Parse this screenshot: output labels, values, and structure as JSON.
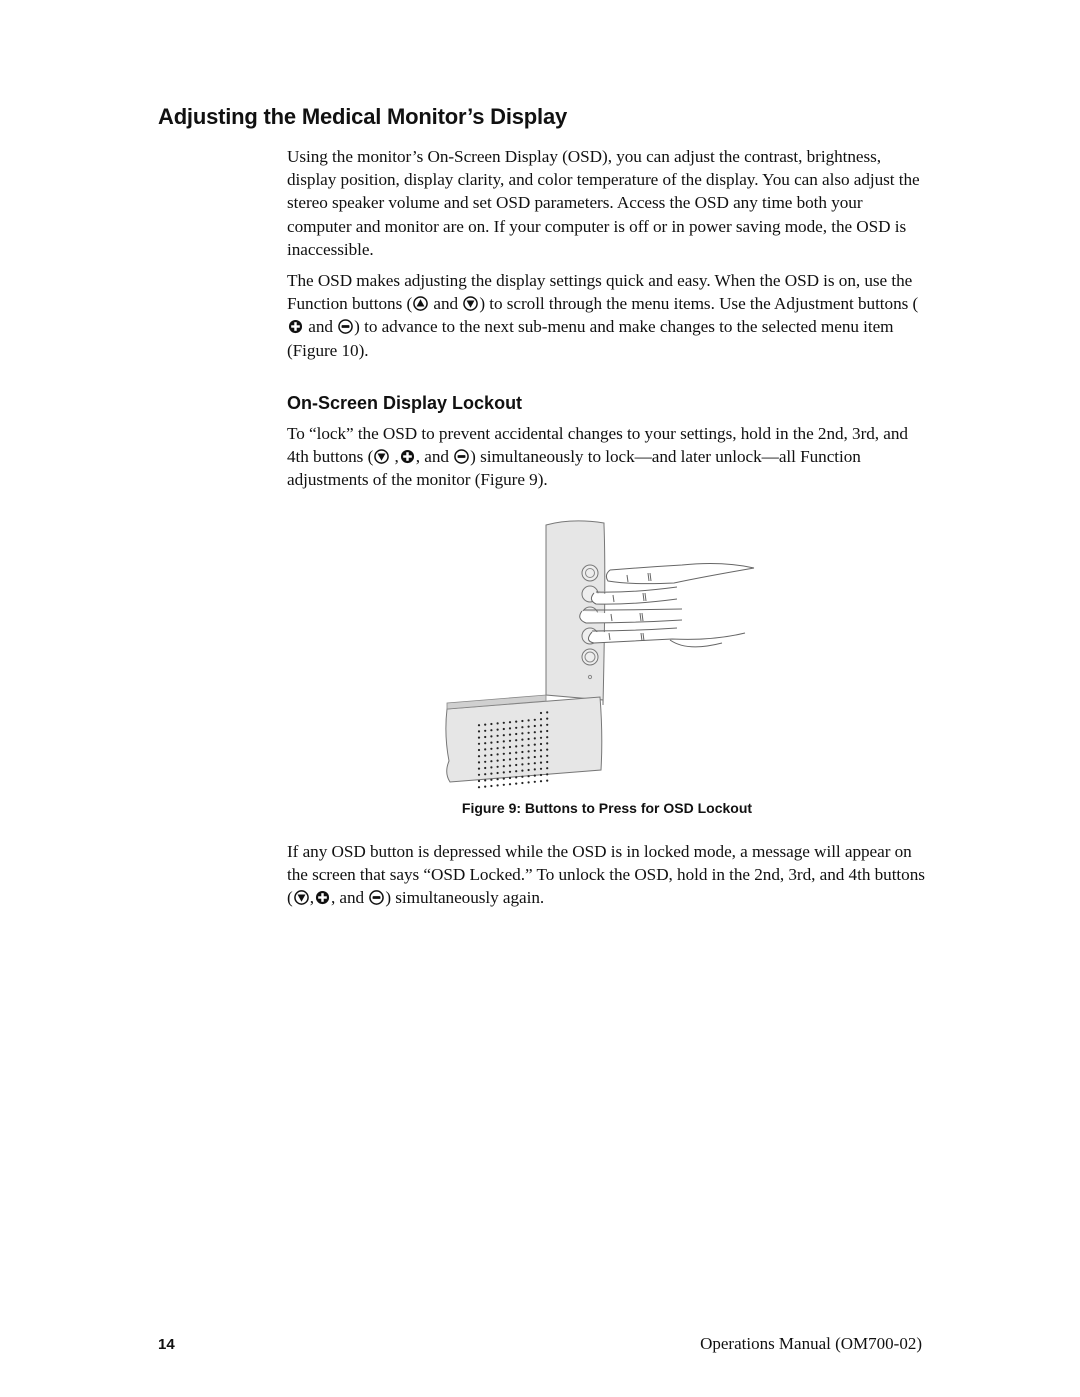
{
  "heading": "Adjusting the Medical Monitor’s Display",
  "intro": "Using the monitor’s On-Screen Display (OSD), you can adjust the contrast, brightness, display position, display clarity, and color temperature of the display. You can also adjust the stereo speaker volume and set OSD parameters. Access the OSD any time both your computer and monitor are on. If your computer is off or in power saving mode, the OSD is inaccessible.",
  "osd_paragraph": {
    "part1": "The OSD makes adjusting the display settings quick and easy. When the OSD is on, use the Function buttons (",
    "and1": " and ",
    "part2": ") to scroll through the menu items. Use the Adjustment buttons (",
    "and2": " and ",
    "part3": ") to advance to the next sub-menu and make changes to the selected menu item (Figure 10)."
  },
  "subheading": "On-Screen Display Lockout",
  "lock_paragraph": {
    "part1": "To “lock” the OSD to prevent accidental changes to your settings, hold in the 2nd, 3rd, and 4th buttons (",
    "sep1": " ,",
    "sep2": ", and ",
    "part2": ") simultaneously to lock—and later unlock—all Function adjustments of the monitor (Figure 9)."
  },
  "figure": {
    "caption": "Figure 9: Buttons to Press for OSD Lockout",
    "buttons": [
      "up-button",
      "down-button",
      "plus-button",
      "minus-button",
      "power-button"
    ]
  },
  "unlock_paragraph": {
    "part1": "If any OSD button is depressed while the OSD is in locked mode, a message will appear on the screen that says “OSD Locked.” To unlock the OSD, hold in the 2nd, 3rd, and 4th buttons (",
    "sep1": ",",
    "sep2": ", and ",
    "part2": ") simultaneously again."
  },
  "icons": {
    "up": "up-arrow-button-icon",
    "down": "down-arrow-button-icon",
    "plus": "plus-button-icon",
    "minus": "minus-button-icon"
  },
  "footer": {
    "page_number": "14",
    "manual_title": "Operations Manual (OM700-02)"
  }
}
